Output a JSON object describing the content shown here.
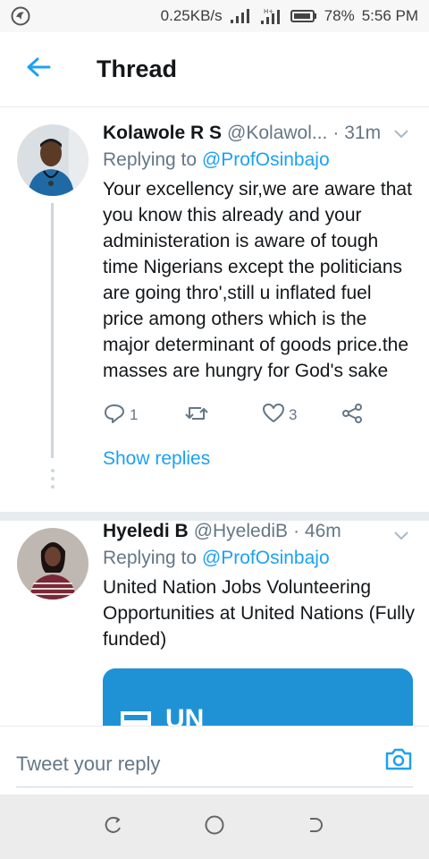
{
  "status_bar": {
    "speed": "0.25KB/s",
    "battery": "78%",
    "time": "5:56 PM"
  },
  "header": {
    "title": "Thread"
  },
  "tweets": [
    {
      "name": "Kolawole R S",
      "handle": "@Kolawol...",
      "time": "· 31m",
      "replying_prefix": "Replying to",
      "replying_to": "@ProfOsinbajo",
      "text": "Your excellency sir,we are aware that you know this already and your administeration is aware of tough time Nigerians except the politicians are going thro',still u inflated fuel price among others which is the major determinant of goods price.the masses are hungry for God's sake",
      "reply_count": "1",
      "like_count": "3",
      "show_replies": "Show replies"
    },
    {
      "name": "Hyeledi B",
      "handle": "@HyelediB",
      "time": "· 46m",
      "replying_prefix": "Replying to",
      "replying_to": "@ProfOsinbajo",
      "text": "United Nation Jobs Volunteering Opportunities at United Nations (Fully funded)",
      "card_text": "UN"
    }
  ],
  "reply_bar": {
    "placeholder": "Tweet your reply"
  },
  "colors": {
    "accent": "#1da1f2",
    "secondary_text": "#657786",
    "divider": "#e6ecf0"
  },
  "icons": {
    "back": "arrow-left-icon",
    "caret": "chevron-down-icon",
    "reply": "reply-icon",
    "retweet": "retweet-icon",
    "like": "heart-icon",
    "share": "share-icon",
    "camera": "camera-icon"
  }
}
